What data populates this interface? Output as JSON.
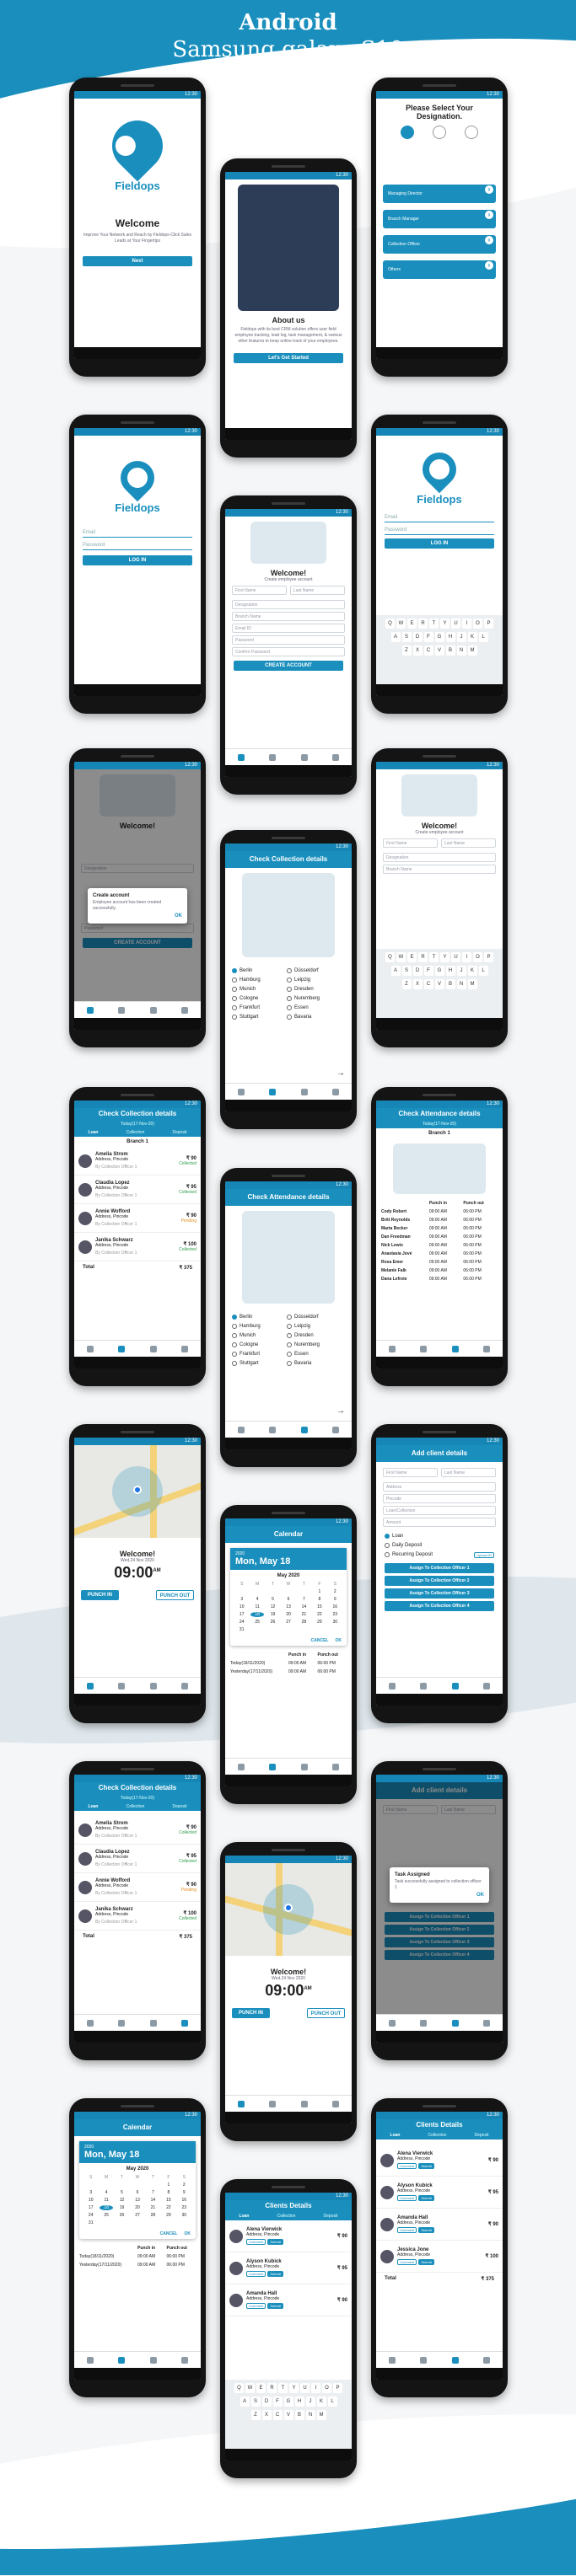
{
  "header": {
    "title": "Android",
    "subtitle": "Samsung galaxy S10"
  },
  "status": {
    "time": "12:30"
  },
  "welcome": {
    "brand": "Fieldops",
    "heading": "Welcome",
    "text": "Improve Your Network and Reach by Fieldops-Click Sales Leads at Your Fingertips",
    "button": "Next"
  },
  "about": {
    "heading": "About us",
    "text": "Fieldops with its best CRM solution offers user field employee tracking, lead log, task management, & various other features to keep online track of your employees.",
    "button": "Let's Get Started"
  },
  "designation": {
    "heading": "Please Select Your Designation.",
    "options": [
      "Managing Director",
      "Branch Manager",
      "Collection Officer",
      "Others"
    ]
  },
  "login": {
    "brand": "Fieldops",
    "email": "Email",
    "password": "Password",
    "button": "LOG IN"
  },
  "keyboard": {
    "rows": [
      [
        "Q",
        "W",
        "E",
        "R",
        "T",
        "Y",
        "U",
        "I",
        "O",
        "P"
      ],
      [
        "A",
        "S",
        "D",
        "F",
        "G",
        "H",
        "J",
        "K",
        "L"
      ],
      [
        "Z",
        "X",
        "C",
        "V",
        "B",
        "N",
        "M"
      ]
    ],
    "suggestion": "The"
  },
  "signup": {
    "heading": "Welcome!",
    "sub": "Create employee account",
    "fields": [
      "First Name",
      "Last Name",
      "Designation",
      "Branch Name",
      "Email ID",
      "Password",
      "Confirm Password"
    ],
    "button": "CREATE ACCOUNT"
  },
  "created_dialog": {
    "title": "Create account",
    "text": "Employee account has been created successfully.",
    "ok": "OK"
  },
  "cities": {
    "title": "Check Collection details",
    "title2": "Check Attendance details",
    "items": [
      "Berlin",
      "Düsseldorf",
      "Hamburg",
      "Leipzig",
      "Munich",
      "Dresden",
      "Cologne",
      "Nuremberg",
      "Frankfurt",
      "Essen",
      "Stuttgart",
      "Bavaria"
    ]
  },
  "collection": {
    "title": "Check Collection details",
    "date": "Today(17-Nov-20)",
    "tabs": [
      "Loan",
      "Collection",
      "Deposit"
    ],
    "branch": "Branch 1",
    "rows": [
      {
        "name": "Amelia Strom",
        "addr": "Address, Pincode",
        "amt": "₹ 90",
        "status": "Collected",
        "by": "By Collection Officer 1"
      },
      {
        "name": "Claudia Lopez",
        "addr": "Address, Pincode",
        "amt": "₹ 95",
        "status": "Collected",
        "by": "By Collection Officer 1"
      },
      {
        "name": "Annie Wofford",
        "addr": "Address, Pincode",
        "amt": "₹ 90",
        "status": "Pending",
        "by": "By Collection Officer 1"
      },
      {
        "name": "Janika Schwarz",
        "addr": "Address, Pincode",
        "amt": "₹ 100",
        "status": "Collected",
        "by": "By Collection Officer 1"
      }
    ],
    "total_label": "Total",
    "total": "₹ 375"
  },
  "attendance": {
    "title": "Check Attendance details",
    "date": "Today(17-Nov-20)",
    "branch": "Branch 1",
    "cols": [
      "",
      "Punch in",
      "Punch out"
    ],
    "rows": [
      [
        "Cody Robert",
        "09:00 AM",
        "06:00 PM"
      ],
      [
        "Britt Reynolds",
        "09:00 AM",
        "06:00 PM"
      ],
      [
        "Marta Becker",
        "09:00 AM",
        "06:00 PM"
      ],
      [
        "Dan Freedman",
        "09:00 AM",
        "06:00 PM"
      ],
      [
        "Nick Lewis",
        "09:00 AM",
        "06:00 PM"
      ],
      [
        "Anastasia Jové",
        "09:00 AM",
        "06:00 PM"
      ],
      [
        "Rosa Emer",
        "09:00 AM",
        "06:00 PM"
      ],
      [
        "Melanie Falk",
        "09:00 AM",
        "06:00 PM"
      ],
      [
        "Dana Lefrote",
        "09:00 AM",
        "06:00 PM"
      ]
    ]
  },
  "punch": {
    "heading": "Welcome!",
    "date": "Wed,24 Nov 2020",
    "time": "09:00",
    "ampm": "AM",
    "in": "PUNCH IN",
    "out": "PUNCH OUT"
  },
  "calendar": {
    "title": "Calendar",
    "year": "2020",
    "date": "Mon, May 18",
    "month": "May 2020",
    "weekdays": [
      "S",
      "M",
      "T",
      "W",
      "T",
      "F",
      "S"
    ],
    "days": [
      "",
      "",
      "",
      "",
      "",
      "1",
      "2",
      "3",
      "4",
      "5",
      "6",
      "7",
      "8",
      "9",
      "10",
      "11",
      "12",
      "13",
      "14",
      "15",
      "16",
      "17",
      "18",
      "19",
      "20",
      "21",
      "22",
      "23",
      "24",
      "25",
      "26",
      "27",
      "28",
      "29",
      "30",
      "31"
    ],
    "selected": "18",
    "cancel": "CANCEL",
    "ok": "OK",
    "log": [
      [
        "",
        "Punch in",
        "Punch out"
      ],
      [
        "Today(18/11/2020)",
        "09:00 AM",
        "06:00 PM"
      ],
      [
        "Yesterday(17/11/2020)",
        "09:00 AM",
        "06:00 PM"
      ]
    ]
  },
  "addclient": {
    "title": "Add client details",
    "fields": [
      "First Name",
      "Last Name",
      "Address",
      "Pincode",
      "Loan/Collection",
      "Amount"
    ],
    "radios": [
      "Loan",
      "Daily Deposit",
      "Recurring Deposit"
    ],
    "upload": "Upload ID",
    "assign": [
      "Assign To Collection Officer 1",
      "Assign To Collection Officer 2",
      "Assign To Collection Officer 3",
      "Assign To Collection Officer 4"
    ]
  },
  "task_dialog": {
    "title": "Task Assigned",
    "text": "Task successfully assigned to collection officer 1",
    "ok": "OK"
  },
  "clients": {
    "title": "Clients Details",
    "tabs": [
      "Loan",
      "Collection",
      "Deposit"
    ],
    "rows": [
      {
        "name": "Alena Vierwick",
        "addr": "Address, Pincode",
        "amt": "₹ 90"
      },
      {
        "name": "Alyson Kubick",
        "addr": "Address, Pincode",
        "amt": "₹ 95"
      },
      {
        "name": "Amanda Hall",
        "addr": "Address, Pincode",
        "amt": "₹ 90"
      },
      {
        "name": "Jessica Jone",
        "addr": "Address, Pincode",
        "amt": "₹ 100"
      }
    ],
    "btn1": "Comment",
    "btn2": "Submit",
    "total_label": "Total",
    "total": "₹ 375"
  }
}
